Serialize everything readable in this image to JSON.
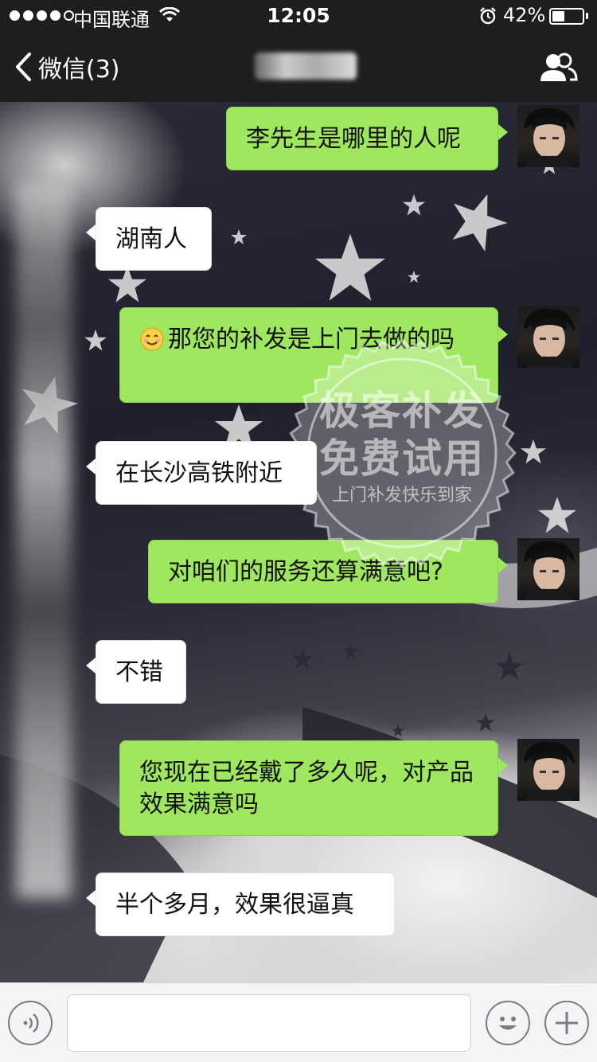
{
  "status_bar": {
    "carrier": "中国联通",
    "time": "12:05",
    "battery_percent": "42%",
    "battery_level": 0.42,
    "signal_bars": 4
  },
  "nav": {
    "back_label": "微信(3)",
    "back_icon": "chevron-left-icon",
    "contacts_icon": "group-contacts-icon"
  },
  "messages": [
    {
      "side": "right",
      "text": "李先生是哪里的人呢"
    },
    {
      "side": "left",
      "text": "湖南人"
    },
    {
      "side": "right",
      "emoji": "smile-emoji",
      "text": "那您的补发是上门去做的吗"
    },
    {
      "side": "left",
      "text": "在长沙高铁附近"
    },
    {
      "side": "right",
      "text": "对咱们的服务还算满意吧?"
    },
    {
      "side": "left",
      "text": "不错"
    },
    {
      "side": "right",
      "text": "您现在已经戴了多久呢，对产品效果满意吗"
    },
    {
      "side": "left",
      "text": "半个多月，效果很逼真"
    }
  ],
  "watermark": {
    "line1": "极客补发",
    "line2": "免费试用",
    "line3": "上门补发快乐到家"
  },
  "input_bar": {
    "voice_icon": "voice-icon",
    "emoji_icon": "emoji-icon",
    "plus_icon": "plus-icon",
    "input_value": ""
  },
  "colors": {
    "bar_bg": "#1e1e20",
    "green_bubble": "#9fe75f",
    "white_bubble": "#ffffff"
  }
}
